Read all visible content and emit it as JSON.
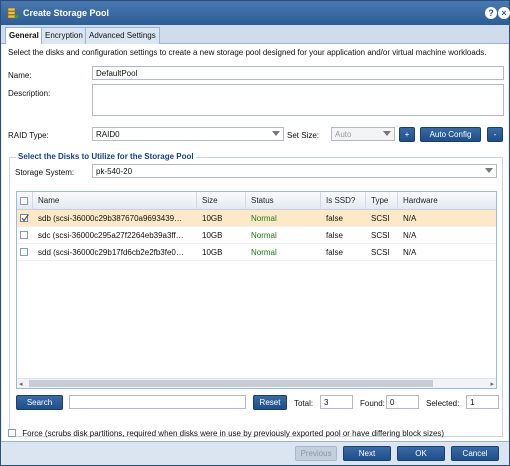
{
  "window": {
    "title": "Create Storage Pool"
  },
  "tabs": [
    {
      "label": "General"
    },
    {
      "label": "Encryption"
    },
    {
      "label": "Advanced Settings"
    }
  ],
  "general": {
    "description_text": "Select the disks and configuration settings to create a new storage pool designed for your application and/or virtual machine workloads.",
    "name_label": "Name:",
    "name_value": "DefaultPool",
    "description_label": "Description:",
    "description_value": "",
    "raid_type_label": "RAID Type:",
    "raid_type_value": "RAID0",
    "set_size_label": "Set Size:",
    "set_size_value": "Auto",
    "plus_label": "+",
    "auto_config_label": "Auto Config",
    "minus_label": "-"
  },
  "disks": {
    "legend": "Select the Disks to Utilize for the Storage Pool",
    "storage_system_label": "Storage System:",
    "storage_system_value": "pk-540-20",
    "columns": [
      "Name",
      "Size",
      "Status",
      "Is SSD?",
      "Type",
      "Hardware"
    ],
    "rows": [
      {
        "checked": true,
        "name": "sdb (scsi-36000c29b387670a9693439…",
        "size": "10GB",
        "status": "Normal",
        "ssd": "false",
        "type": "SCSI",
        "hardware": "N/A"
      },
      {
        "checked": false,
        "name": "sdc (scsi-36000c295a27f2264eb39a3ff…",
        "size": "10GB",
        "status": "Normal",
        "ssd": "false",
        "type": "SCSI",
        "hardware": "N/A"
      },
      {
        "checked": false,
        "name": "sdd (scsi-36000c29b17fd6cb2e2fb3fe0…",
        "size": "10GB",
        "status": "Normal",
        "ssd": "false",
        "type": "SCSI",
        "hardware": "N/A"
      }
    ]
  },
  "search": {
    "search_label": "Search",
    "search_value": "",
    "reset_label": "Reset",
    "total_label": "Total:",
    "total_value": "3",
    "found_label": "Found:",
    "found_value": "0",
    "selected_label": "Selected:",
    "selected_value": "1"
  },
  "force": {
    "label": "Force (scrubs disk partitions, required when disks were in use by previously exported pool or have differing block sizes)"
  },
  "footer": {
    "previous_label": "Previous",
    "next_label": "Next",
    "ok_label": "OK",
    "cancel_label": "Cancel"
  },
  "colors": {
    "accent": "#2e5d96",
    "selected_row": "#fde9c8",
    "status_normal": "#1a7a1a"
  }
}
